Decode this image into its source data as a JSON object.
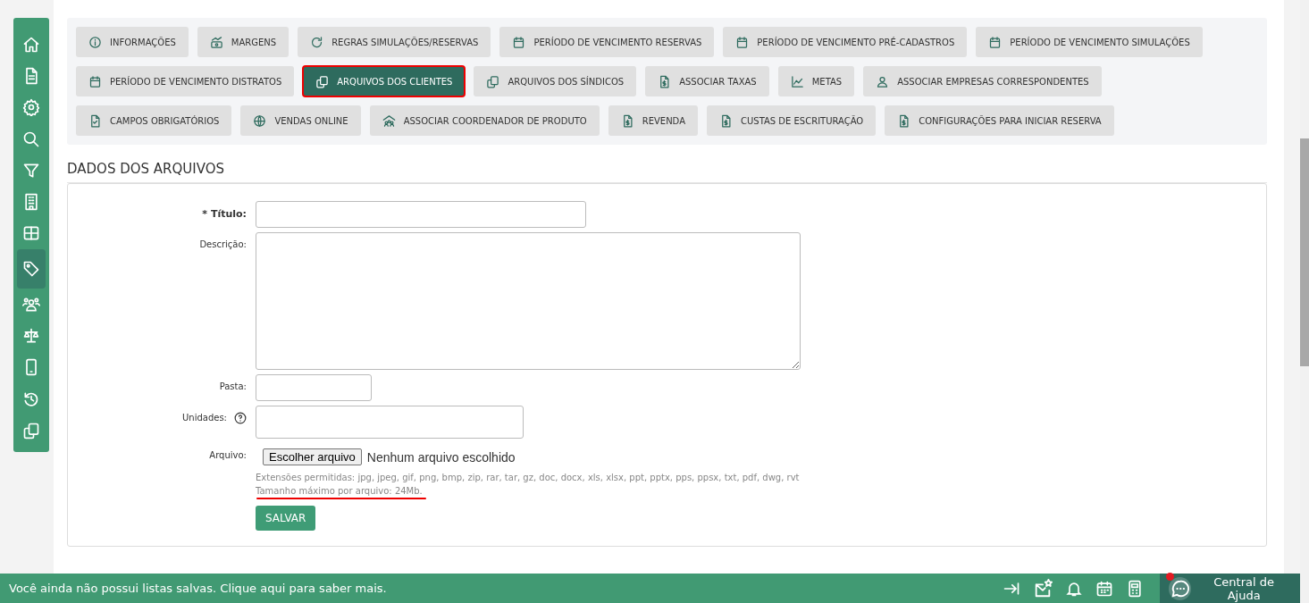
{
  "sidebar": {
    "items": [
      {
        "selected": false
      },
      {
        "selected": false
      },
      {
        "selected": false
      },
      {
        "selected": false
      },
      {
        "selected": false
      },
      {
        "selected": false
      },
      {
        "selected": false
      },
      {
        "selected": true
      },
      {
        "selected": false
      },
      {
        "selected": false
      },
      {
        "selected": false
      },
      {
        "selected": false
      },
      {
        "selected": false
      }
    ]
  },
  "tab_rows": [
    {
      "tabs": [
        {
          "label": "INFORMAÇÕES",
          "selected": false
        },
        {
          "label": "MARGENS",
          "selected": false
        },
        {
          "label": "REGRAS SIMULAÇÕES/RESERVAS",
          "selected": false
        },
        {
          "label": "PERÍODO DE VENCIMENTO RESERVAS",
          "selected": false
        },
        {
          "label": "PERÍODO DE VENCIMENTO PRÉ-CADASTROS",
          "selected": false
        },
        {
          "label": "PERÍODO DE VENCIMENTO SIMULAÇÕES",
          "selected": false
        }
      ]
    },
    {
      "tabs": [
        {
          "label": "PERÍODO DE VENCIMENTO DISTRATOS",
          "selected": false
        },
        {
          "label": "ARQUIVOS DOS CLIENTES",
          "selected": true
        },
        {
          "label": "ARQUIVOS DOS SÍNDICOS",
          "selected": false
        },
        {
          "label": "ASSOCIAR TAXAS",
          "selected": false
        },
        {
          "label": "METAS",
          "selected": false
        },
        {
          "label": "ASSOCIAR EMPRESAS CORRESPONDENTES",
          "selected": false
        }
      ]
    },
    {
      "tabs": [
        {
          "label": "CAMPOS OBRIGATÓRIOS",
          "selected": false
        },
        {
          "label": "VENDAS ONLINE",
          "selected": false
        },
        {
          "label": "ASSOCIAR COORDENADOR DE PRODUTO",
          "selected": false
        },
        {
          "label": "REVENDA",
          "selected": false
        },
        {
          "label": "CUSTAS DE ESCRITURAÇÃO",
          "selected": false
        },
        {
          "label": "CONFIGURAÇÕES PARA INICIAR RESERVA",
          "selected": false
        }
      ]
    }
  ],
  "section_title": "DADOS DOS ARQUIVOS",
  "form": {
    "fields": [
      {
        "kind": "text",
        "label": "* Título:",
        "required": true
      },
      {
        "kind": "textarea",
        "label": "Descrição:",
        "required": false
      },
      {
        "kind": "short",
        "label": "Pasta:",
        "required": false
      },
      {
        "kind": "units",
        "label": "Unidades:",
        "required": false
      },
      {
        "kind": "file",
        "label": "Arquivo:",
        "required": false,
        "button": "Escolher arquivo",
        "value": "Nenhum arquivo escolhido"
      }
    ],
    "hints": [
      "Extensões permitidas: jpg, jpeg, gif, png, bmp, zip, rar, tar, gz, doc, docx, xls, xlsx, ppt, pptx, pps, ppsx, txt, pdf, dwg, rvt",
      "Tamanho máximo por arquivo: 24Mb."
    ],
    "save_button": "SALVAR"
  },
  "footer": {
    "message": "Você ainda não possui listas salvas. Clique aqui para saber mais.",
    "help": "Central de Ajuda"
  }
}
